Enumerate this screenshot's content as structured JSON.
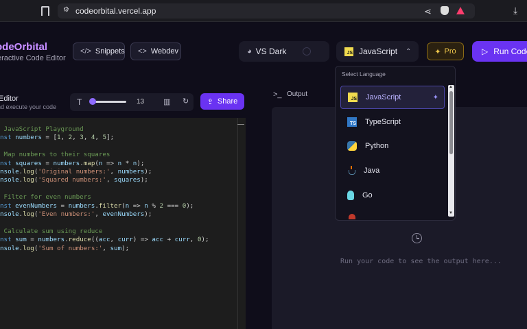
{
  "browser": {
    "url": "codeorbital.vercel.app"
  },
  "header": {
    "app_title": "odeOrbital",
    "app_subtitle": "eractive Code Editor",
    "snippets_label": "Snippets",
    "webdev_label": "Webdev",
    "theme_label": "VS Dark",
    "language_label": "JavaScript",
    "pro_label": "Pro",
    "run_label": "Run Code"
  },
  "editor": {
    "title": "Editor",
    "subtitle": "nd execute your code",
    "font_size": "13",
    "share_label": "Share",
    "code_lines": [
      {
        "cls": "cm",
        "text": " JavaScript Playground"
      },
      {
        "parts": [
          [
            "kw",
            "nst "
          ],
          [
            "var",
            "numbers"
          ],
          [
            "pl",
            " = ["
          ],
          [
            "num",
            "1"
          ],
          [
            "pl",
            ", "
          ],
          [
            "num",
            "2"
          ],
          [
            "pl",
            ", "
          ],
          [
            "num",
            "3"
          ],
          [
            "pl",
            ", "
          ],
          [
            "num",
            "4"
          ],
          [
            "pl",
            ", "
          ],
          [
            "num",
            "5"
          ],
          [
            "pl",
            "];"
          ]
        ]
      },
      {
        "cls": "pl",
        "text": ""
      },
      {
        "cls": "cm",
        "text": " Map numbers to their squares"
      },
      {
        "parts": [
          [
            "kw",
            "nst "
          ],
          [
            "var",
            "squares"
          ],
          [
            "pl",
            " = "
          ],
          [
            "var",
            "numbers"
          ],
          [
            "pl",
            "."
          ],
          [
            "fn",
            "map"
          ],
          [
            "pl",
            "("
          ],
          [
            "var",
            "n"
          ],
          [
            "pl",
            " => "
          ],
          [
            "var",
            "n"
          ],
          [
            "pl",
            " * "
          ],
          [
            "var",
            "n"
          ],
          [
            "pl",
            ");"
          ]
        ]
      },
      {
        "parts": [
          [
            "var",
            "nsole"
          ],
          [
            "pl",
            "."
          ],
          [
            "fn",
            "log"
          ],
          [
            "pl",
            "("
          ],
          [
            "str",
            "'Original numbers:'"
          ],
          [
            "pl",
            ", "
          ],
          [
            "var",
            "numbers"
          ],
          [
            "pl",
            ");"
          ]
        ]
      },
      {
        "parts": [
          [
            "var",
            "nsole"
          ],
          [
            "pl",
            "."
          ],
          [
            "fn",
            "log"
          ],
          [
            "pl",
            "("
          ],
          [
            "str",
            "'Squared numbers:'"
          ],
          [
            "pl",
            ", "
          ],
          [
            "var",
            "squares"
          ],
          [
            "pl",
            ");"
          ]
        ]
      },
      {
        "cls": "pl",
        "text": ""
      },
      {
        "cls": "cm",
        "text": " Filter for even numbers"
      },
      {
        "parts": [
          [
            "kw",
            "nst "
          ],
          [
            "var",
            "evenNumbers"
          ],
          [
            "pl",
            " = "
          ],
          [
            "var",
            "numbers"
          ],
          [
            "pl",
            "."
          ],
          [
            "fn",
            "filter"
          ],
          [
            "pl",
            "("
          ],
          [
            "var",
            "n"
          ],
          [
            "pl",
            " => "
          ],
          [
            "var",
            "n"
          ],
          [
            "pl",
            " % "
          ],
          [
            "num",
            "2"
          ],
          [
            "pl",
            " === "
          ],
          [
            "num",
            "0"
          ],
          [
            "pl",
            ");"
          ]
        ]
      },
      {
        "parts": [
          [
            "var",
            "nsole"
          ],
          [
            "pl",
            "."
          ],
          [
            "fn",
            "log"
          ],
          [
            "pl",
            "("
          ],
          [
            "str",
            "'Even numbers:'"
          ],
          [
            "pl",
            ", "
          ],
          [
            "var",
            "evenNumbers"
          ],
          [
            "pl",
            ");"
          ]
        ]
      },
      {
        "cls": "pl",
        "text": ""
      },
      {
        "cls": "cm",
        "text": " Calculate sum using reduce"
      },
      {
        "parts": [
          [
            "kw",
            "nst "
          ],
          [
            "var",
            "sum"
          ],
          [
            "pl",
            " = "
          ],
          [
            "var",
            "numbers"
          ],
          [
            "pl",
            "."
          ],
          [
            "fn",
            "reduce"
          ],
          [
            "pl",
            "(("
          ],
          [
            "var",
            "acc"
          ],
          [
            "pl",
            ", "
          ],
          [
            "var",
            "curr"
          ],
          [
            "pl",
            ") => "
          ],
          [
            "var",
            "acc"
          ],
          [
            "pl",
            " + "
          ],
          [
            "var",
            "curr"
          ],
          [
            "pl",
            ", "
          ],
          [
            "num",
            "0"
          ],
          [
            "pl",
            ");"
          ]
        ]
      },
      {
        "parts": [
          [
            "var",
            "nsole"
          ],
          [
            "pl",
            "."
          ],
          [
            "fn",
            "log"
          ],
          [
            "pl",
            "("
          ],
          [
            "str",
            "'Sum of numbers:'"
          ],
          [
            "pl",
            ", "
          ],
          [
            "var",
            "sum"
          ],
          [
            "pl",
            ");"
          ]
        ]
      }
    ]
  },
  "output": {
    "title": "Output",
    "hint": "Run your code to see the output here..."
  },
  "language_dropdown": {
    "label": "Select Language",
    "items": [
      {
        "name": "JavaScript",
        "icon": "js-icon",
        "selected": true
      },
      {
        "name": "TypeScript",
        "icon": "ts-icon"
      },
      {
        "name": "Python",
        "icon": "python-icon"
      },
      {
        "name": "Java",
        "icon": "java-icon"
      },
      {
        "name": "Go",
        "icon": "go-icon"
      }
    ]
  },
  "colors": {
    "accent": "#6a33f2",
    "background": "#0f0d1a",
    "pro": "#f2c94c"
  }
}
